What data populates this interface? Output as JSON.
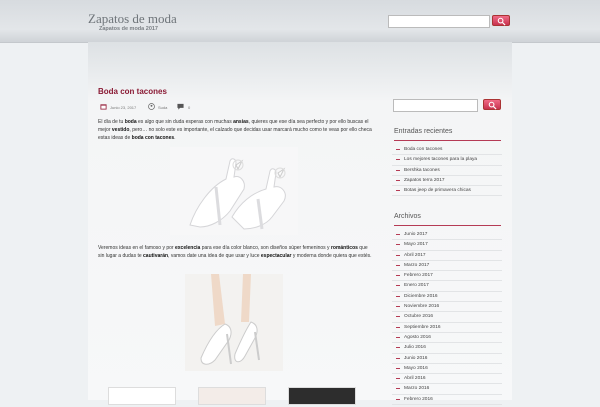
{
  "site": {
    "title": "Zapatos de moda",
    "description": "Zapatos de moda 2017"
  },
  "header_search": {
    "value": "",
    "placeholder": ""
  },
  "post": {
    "title": "Boda con tacones",
    "date": "Junio 23, 2017",
    "author": "Suda",
    "comments": "0",
    "paragraph1": [
      {
        "t": "El día de tu "
      },
      {
        "b": "boda"
      },
      {
        "t": " es algo que sin duda esperas con muchas "
      },
      {
        "b": "ansias"
      },
      {
        "t": ", quieres que ese día sea perfecto y por ello buscas el mejor "
      },
      {
        "b": "vestido"
      },
      {
        "t": ", pero… no solo este es importante, el calzado que decidas usar marcará mucho como te veas por ello checa estas ideas de "
      },
      {
        "b": "boda con tacones"
      },
      {
        "t": "."
      }
    ],
    "paragraph2": [
      {
        "t": "Veremos ideas en el famoso y por "
      },
      {
        "b": "excelencia"
      },
      {
        "t": " para ese día color blanco, son diseños súper femeninos y "
      },
      {
        "b": "románticos"
      },
      {
        "t": " que sin lugar a dudas te "
      },
      {
        "b": "cautivarán"
      },
      {
        "t": ", vamos date una idea de que usar y luce "
      },
      {
        "b": "espectacular"
      },
      {
        "t": " y moderna donde quiera que estés."
      }
    ]
  },
  "sidebar": {
    "search": {
      "value": "",
      "placeholder": ""
    },
    "recent_title": "Entradas recientes",
    "recent": [
      "Boda con tacones",
      "Los mejores tacones para la playa",
      "Bershka tacones",
      "Zapatos terra 2017",
      "Botas jeep de primavera chicas"
    ],
    "archives_title": "Archivos",
    "archives": [
      "Junio 2017",
      "Mayo 2017",
      "Abril 2017",
      "Marzo 2017",
      "Febrero 2017",
      "Enero 2017",
      "Diciembre 2016",
      "Noviembre 2016",
      "Octubre 2016",
      "Septiembre 2016",
      "Agosto 2016",
      "Julio 2016",
      "Junio 2016",
      "Mayo 2016",
      "Abril 2016",
      "Marzo 2016",
      "Febrero 2016"
    ]
  },
  "colors": {
    "accent": "#b53b55",
    "title": "#8a1a34",
    "button": "#e0506e"
  }
}
